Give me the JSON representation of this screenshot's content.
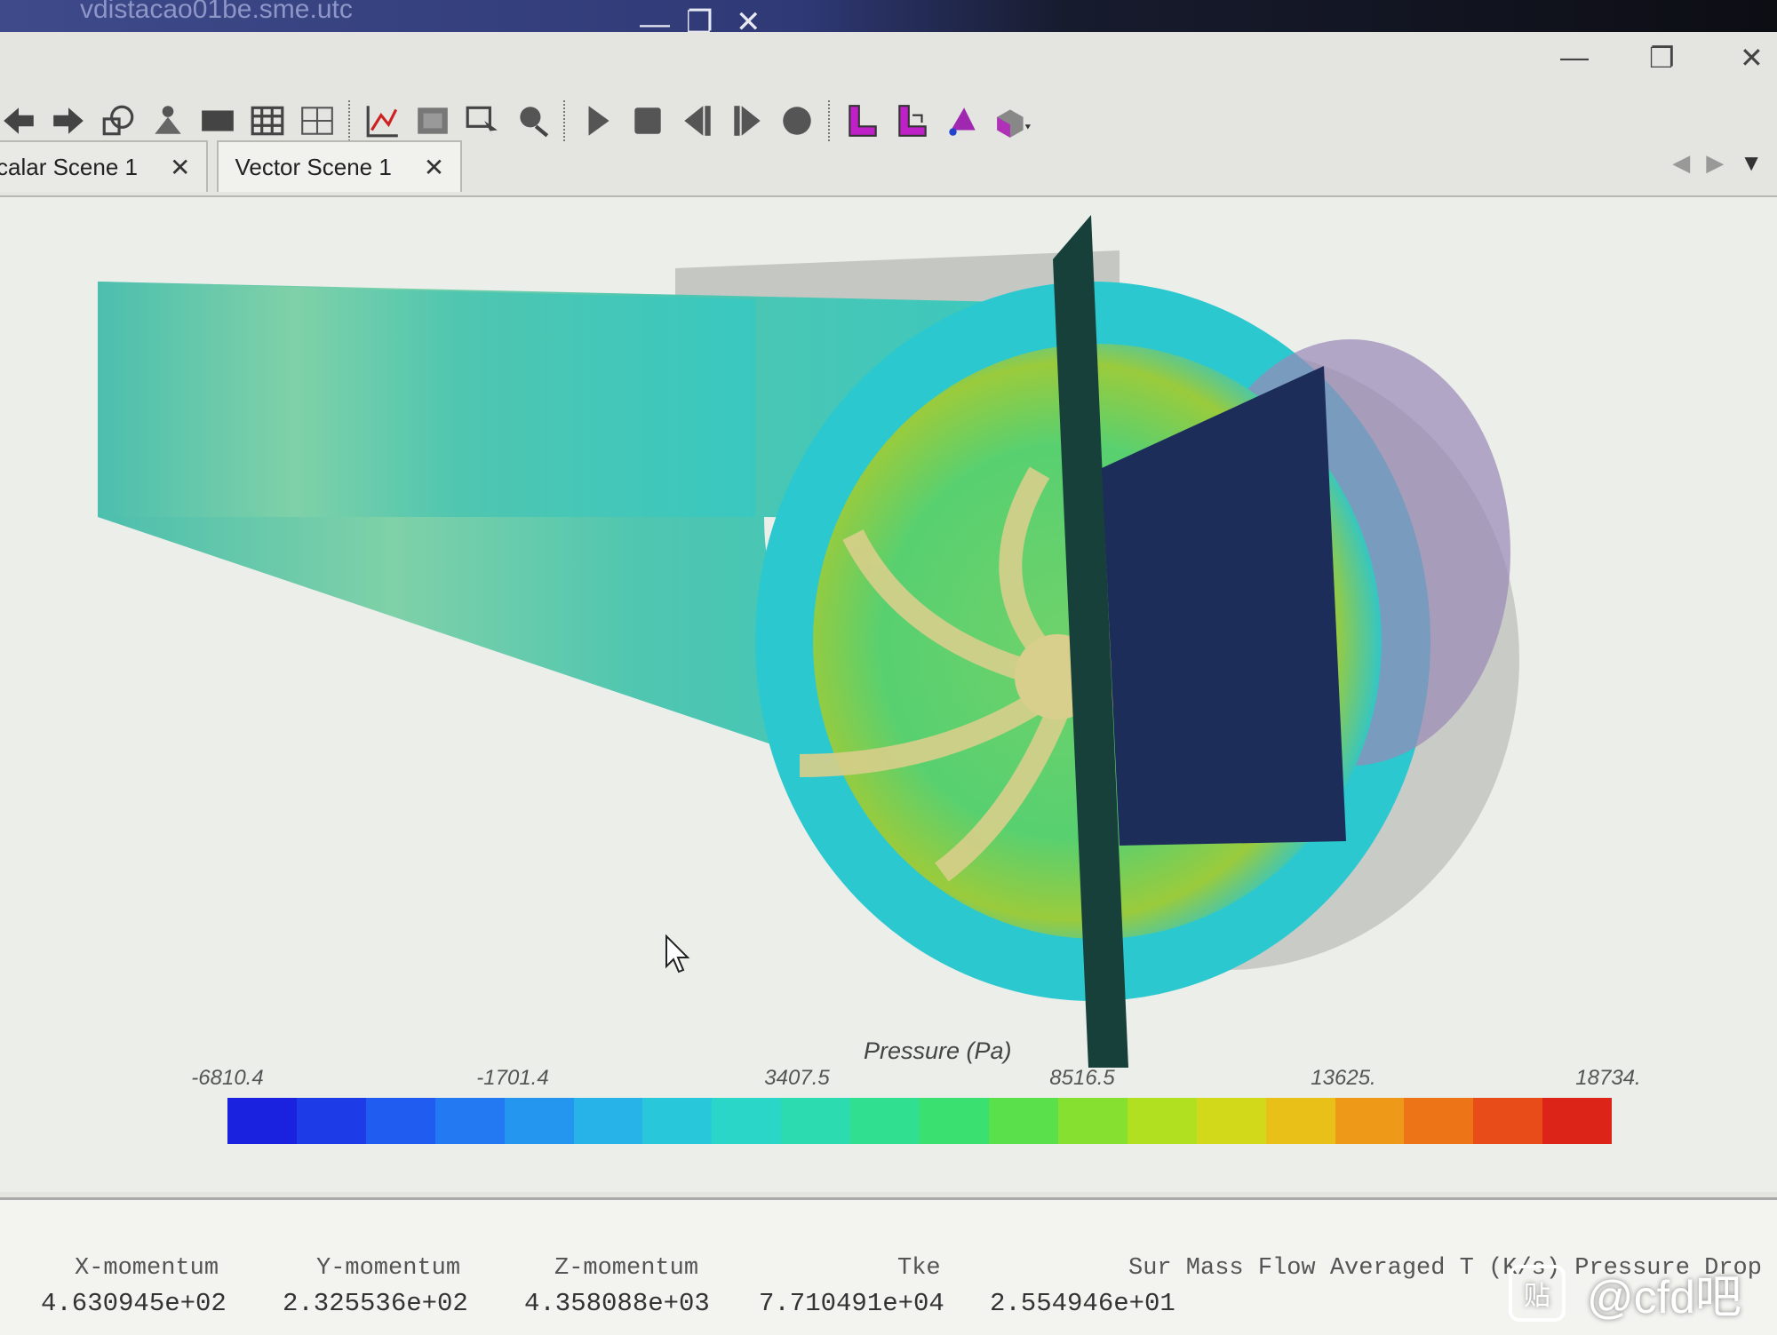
{
  "window": {
    "title": "vdistacao01be.sme.utc",
    "minimize": "—",
    "restore": "❐",
    "close": "✕"
  },
  "app_controls": {
    "minimize": "—",
    "restore": "❐",
    "close": "✕"
  },
  "toolbar": {
    "icons": [
      "back-icon",
      "forward-icon",
      "shapes-icon",
      "person-icon",
      "panel-icon",
      "grid-icon",
      "grid-alt-icon",
      "chart-icon",
      "region-icon",
      "select-icon",
      "probe-icon",
      "play-icon",
      "stop-icon",
      "step-back-icon",
      "step-forward-icon",
      "record-icon",
      "view-l-icon",
      "view-l2-icon",
      "view-3d-icon",
      "view-iso-icon"
    ]
  },
  "tabs": [
    {
      "label": "calar Scene 1",
      "close": "✕"
    },
    {
      "label": "Vector Scene 1",
      "close": "✕"
    }
  ],
  "tab_nav": {
    "prev": "◀",
    "next": "▶",
    "menu": "▼"
  },
  "legend": {
    "title": "Pressure (Pa)",
    "ticks": [
      "-6810.4",
      "-1701.4",
      "3407.5",
      "8516.5",
      "13625.",
      "18734."
    ],
    "colors": [
      "#1a22e0",
      "#1d3ce8",
      "#1f5cef",
      "#2279f2",
      "#2596f0",
      "#27b2e8",
      "#28c8da",
      "#2ad6c8",
      "#2cdcb0",
      "#30e090",
      "#3ae070",
      "#5ae04a",
      "#86e030",
      "#b0e020",
      "#d2d81a",
      "#e8c018",
      "#ee9a18",
      "#ee7418",
      "#e84c18",
      "#dc2418"
    ]
  },
  "console": {
    "headers": [
      "X-momentum",
      "Y-momentum",
      "Z-momentum",
      "Tke",
      "Sur Mass Flow Averaged T (K/s) Pressure Drop"
    ],
    "row1": [
      "4.630945e+02",
      "2.325536e+02",
      "4.358088e+03",
      "7.710491e+04",
      "2.554946e+01"
    ]
  },
  "watermark": {
    "icon": "贴",
    "text": "@cfd吧"
  }
}
